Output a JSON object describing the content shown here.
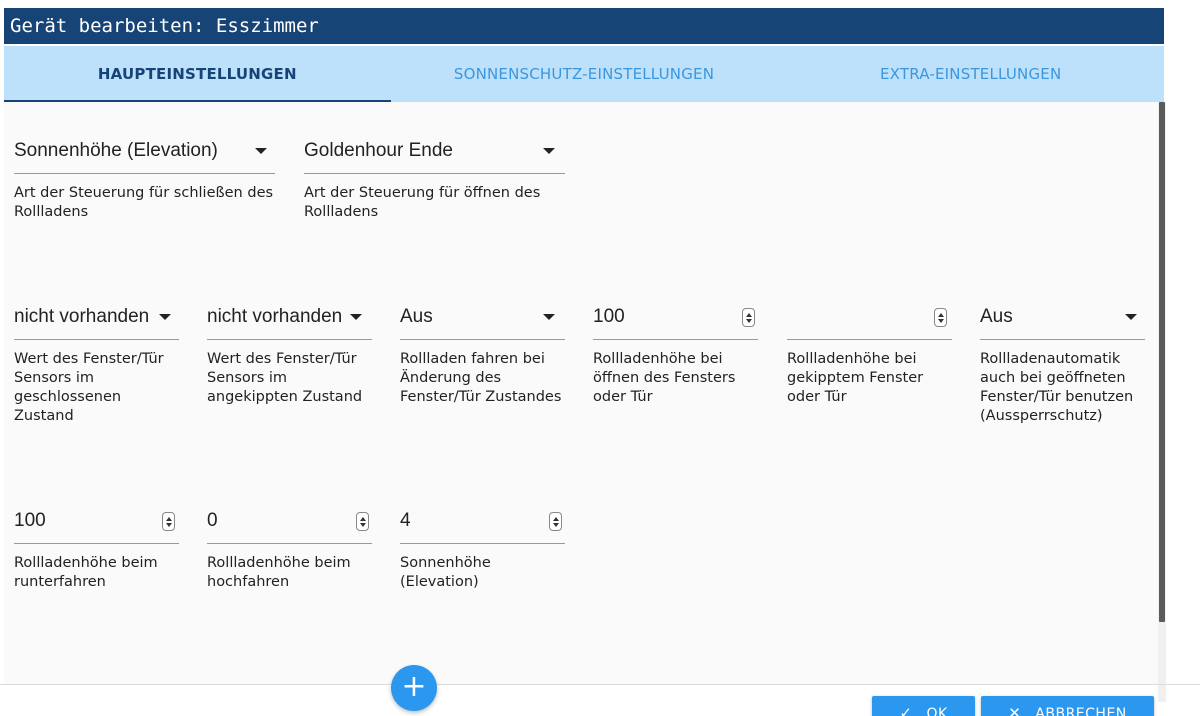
{
  "dialog": {
    "title": "Gerät bearbeiten: Esszimmer"
  },
  "tabs": [
    {
      "label": "HAUPTEINSTELLUNGEN",
      "active": true
    },
    {
      "label": "SONNENSCHUTZ-EINSTELLUNGEN",
      "active": false
    },
    {
      "label": "EXTRA-EINSTELLUNGEN",
      "active": false
    }
  ],
  "fields": {
    "close_control": {
      "value": "Sonnenhöhe (Elevation)",
      "label": "Art der Steuerung für schließen des Rollladens"
    },
    "open_control": {
      "value": "Goldenhour Ende",
      "label": "Art der Steuerung für öffnen des Rollladens"
    },
    "sensor_closed": {
      "value": "nicht vorhanden",
      "label": "Wert des Fenster/Tür Sensors im geschlossenen Zustand"
    },
    "sensor_tilted": {
      "value": "nicht vorhanden",
      "label": "Wert des Fenster/Tür Sensors im angekippten Zustand"
    },
    "move_on_change": {
      "value": "Aus",
      "label": "Rollladen fahren bei Änderung des Fenster/Tür Zustandes"
    },
    "height_open": {
      "value": "100",
      "label": "Rollladenhöhe bei öffnen des Fensters oder Tür"
    },
    "height_tilted": {
      "value": "",
      "label": "Rollladenhöhe bei gekipptem Fenster oder Tür"
    },
    "lockout": {
      "value": "Aus",
      "label": "Rollladenautomatik auch bei geöffneten Fenster/Tür benutzen (Aussperrschutz)"
    },
    "height_down": {
      "value": "100",
      "label": "Rollladenhöhe beim runterfahren"
    },
    "height_up": {
      "value": "0",
      "label": "Rollladenhöhe beim hochfahren"
    },
    "elevation": {
      "value": "4",
      "label": "Sonnenhöhe (Elevation)"
    }
  },
  "fab": {
    "icon": "plus-icon",
    "symbol": "+"
  },
  "buttons": {
    "ok": {
      "label": "OK",
      "icon": "check-icon",
      "symbol": "✓"
    },
    "cancel": {
      "label": "ABBRECHEN",
      "icon": "close-icon",
      "symbol": "✕"
    }
  },
  "colors": {
    "title_bar": "#164477",
    "tab_bar": "#bde0fb",
    "tab_active_text": "#164477",
    "tab_inactive_text": "#3b97dd",
    "accent_button": "#2b97ee"
  }
}
